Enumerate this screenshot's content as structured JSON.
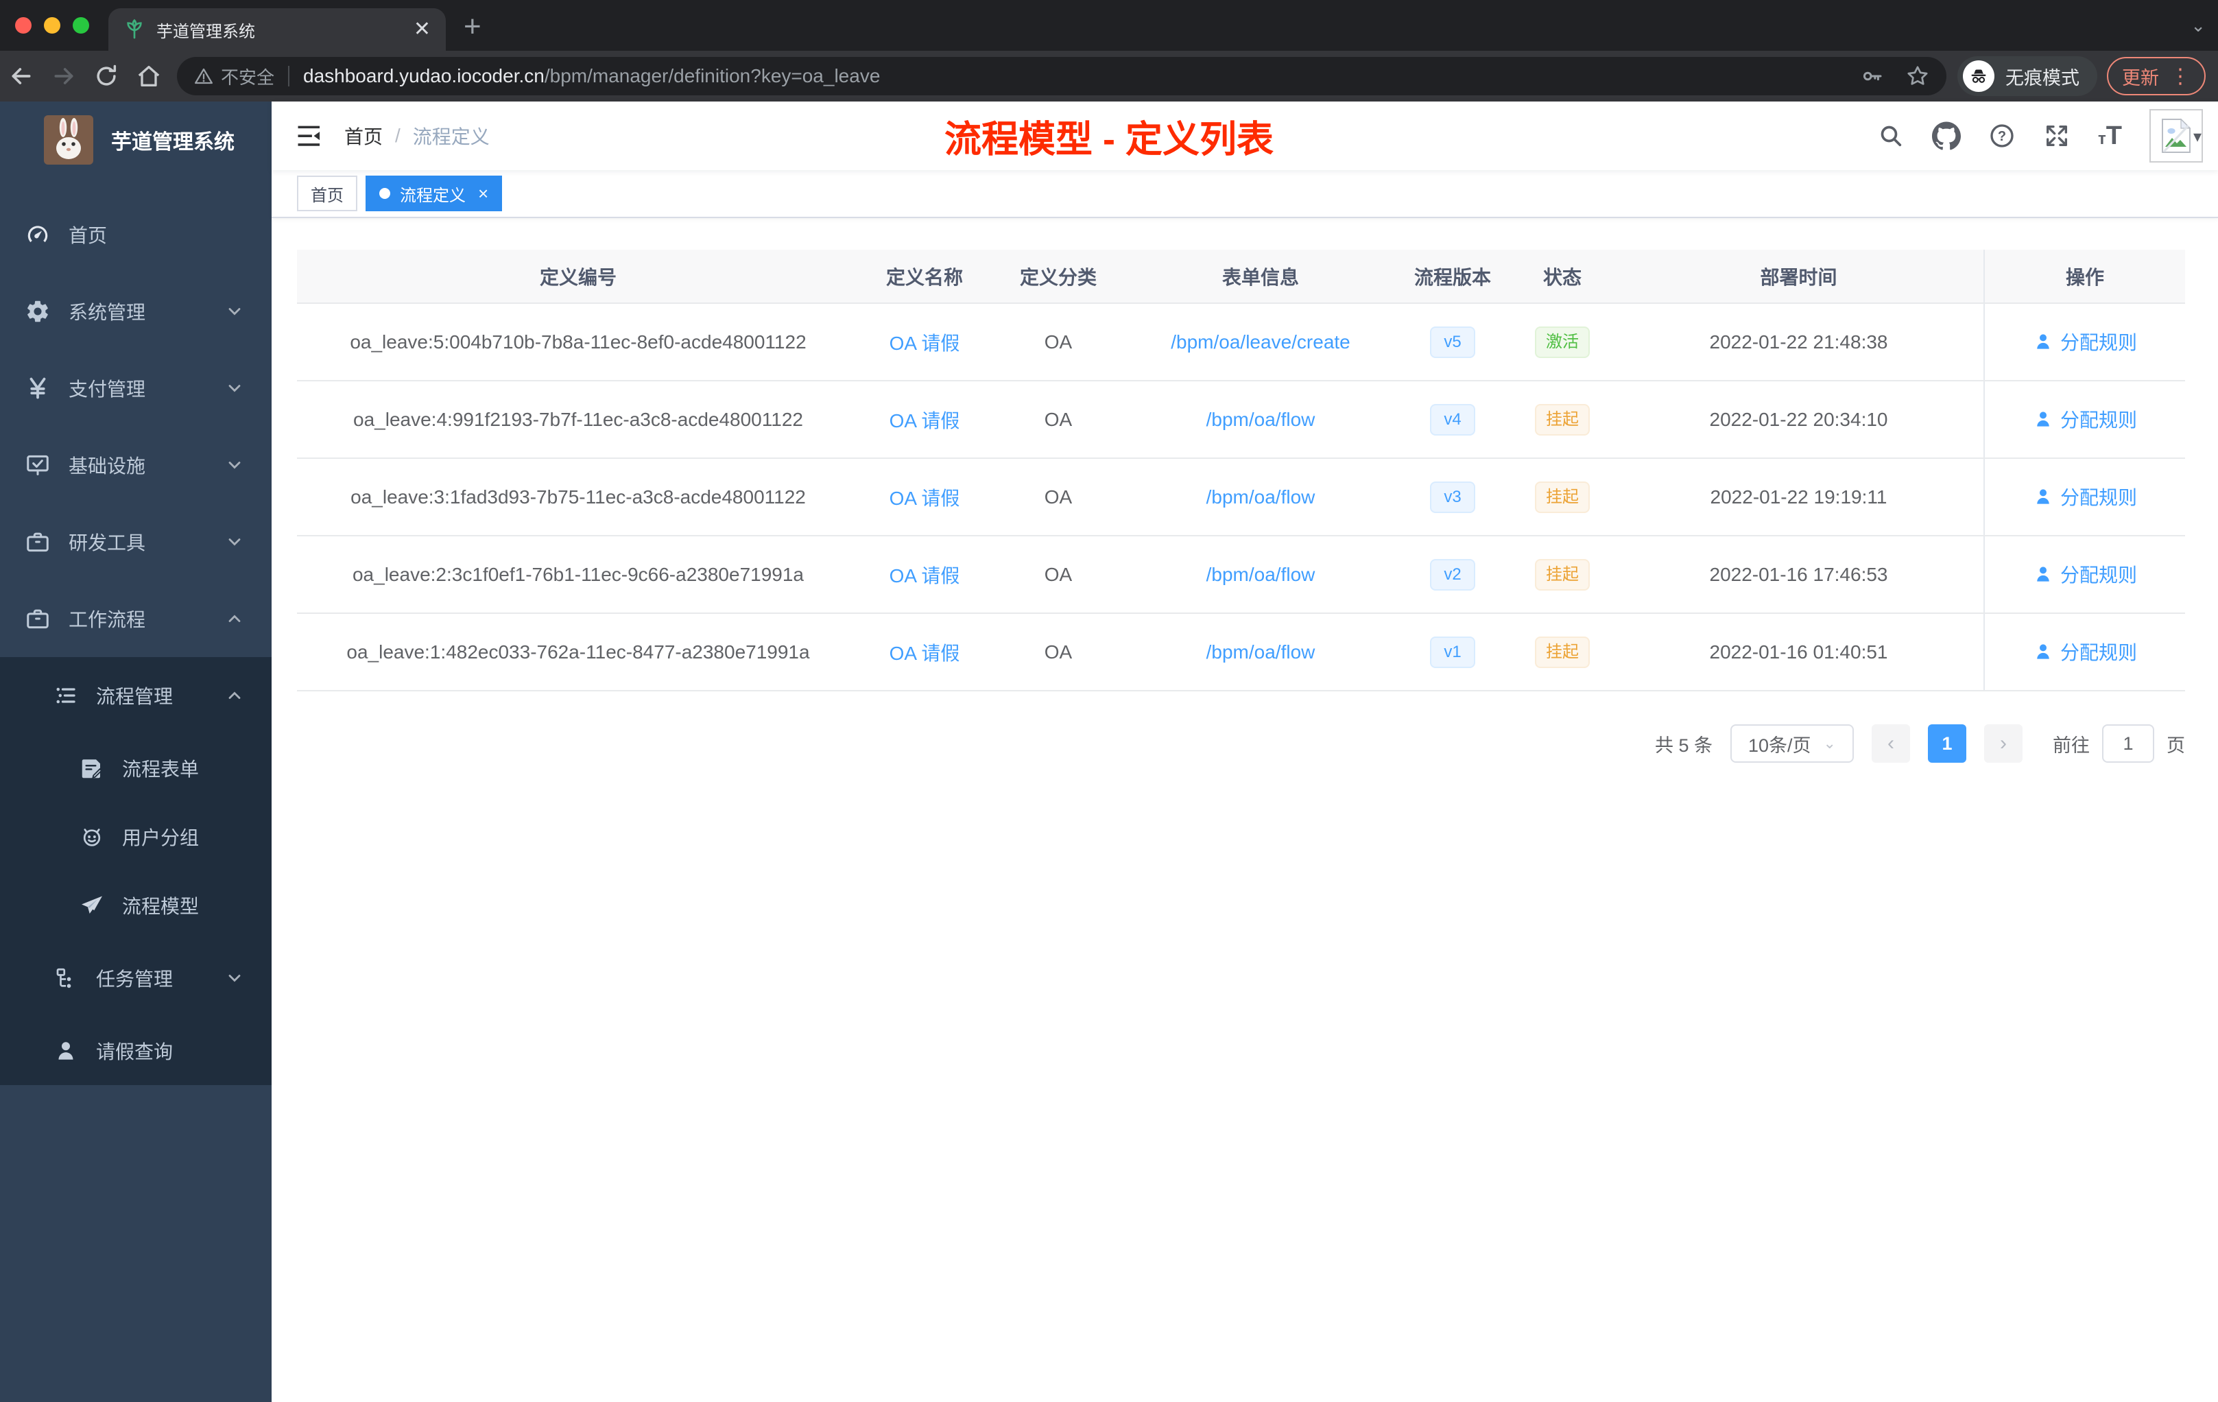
{
  "browser": {
    "tab": {
      "title": "芋道管理系统"
    },
    "address": {
      "security": "不安全",
      "host": "dashboard.yudao.iocoder.cn",
      "path": "/bpm/manager/definition?key=oa_leave"
    },
    "incognito_label": "无痕模式",
    "update_label": "更新"
  },
  "sidebar": {
    "logo_title": "芋道管理系统",
    "items": [
      {
        "label": "首页"
      },
      {
        "label": "系统管理"
      },
      {
        "label": "支付管理"
      },
      {
        "label": "基础设施"
      },
      {
        "label": "研发工具"
      },
      {
        "label": "工作流程"
      },
      {
        "label": "流程管理"
      },
      {
        "label": "流程表单"
      },
      {
        "label": "用户分组"
      },
      {
        "label": "流程模型"
      },
      {
        "label": "任务管理"
      },
      {
        "label": "请假查询"
      }
    ]
  },
  "navbar": {
    "breadcrumb": {
      "home": "首页",
      "separator": "/",
      "current": "流程定义"
    },
    "annotation": "流程模型 - 定义列表"
  },
  "tags": {
    "home": "首页",
    "active": "流程定义",
    "close": "×"
  },
  "table": {
    "columns": [
      "定义编号",
      "定义名称",
      "定义分类",
      "表单信息",
      "流程版本",
      "状态",
      "部署时间",
      "操作"
    ],
    "rows": [
      {
        "id": "oa_leave:5:004b710b-7b8a-11ec-8ef0-acde48001122",
        "name": "OA 请假",
        "category": "OA",
        "form": "/bpm/oa/leave/create",
        "version": "v5",
        "status": "激活",
        "time": "2022-01-22 21:48:38",
        "action": "分配规则"
      },
      {
        "id": "oa_leave:4:991f2193-7b7f-11ec-a3c8-acde48001122",
        "name": "OA 请假",
        "category": "OA",
        "form": "/bpm/oa/flow",
        "version": "v4",
        "status": "挂起",
        "time": "2022-01-22 20:34:10",
        "action": "分配规则"
      },
      {
        "id": "oa_leave:3:1fad3d93-7b75-11ec-a3c8-acde48001122",
        "name": "OA 请假",
        "category": "OA",
        "form": "/bpm/oa/flow",
        "version": "v3",
        "status": "挂起",
        "time": "2022-01-22 19:19:11",
        "action": "分配规则"
      },
      {
        "id": "oa_leave:2:3c1f0ef1-76b1-11ec-9c66-a2380e71991a",
        "name": "OA 请假",
        "category": "OA",
        "form": "/bpm/oa/flow",
        "version": "v2",
        "status": "挂起",
        "time": "2022-01-16 17:46:53",
        "action": "分配规则"
      },
      {
        "id": "oa_leave:1:482ec033-762a-11ec-8477-a2380e71991a",
        "name": "OA 请假",
        "category": "OA",
        "form": "/bpm/oa/flow",
        "version": "v1",
        "status": "挂起",
        "time": "2022-01-16 01:40:51",
        "action": "分配规则"
      }
    ]
  },
  "pagination": {
    "total": "共 5 条",
    "page_size": "10条/页",
    "prev": "‹",
    "page": "1",
    "next": "›",
    "goto_label": "前往",
    "goto_value": "1",
    "unit": "页"
  },
  "colors": {
    "primary": "#409eff",
    "tag_active": "#2d8cf0",
    "annotation_red": "#fe2b00",
    "sidebar_bg": "#304156",
    "submenu_bg": "#1f2d3d",
    "status_active_text": "#4fbe42",
    "status_suspend_text": "#eca335",
    "update_pill": "#ee8878"
  }
}
